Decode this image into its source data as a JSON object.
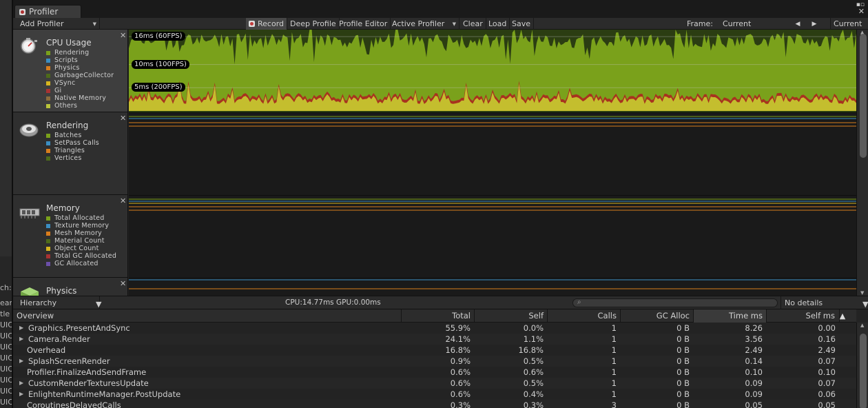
{
  "left_strip_fragments": [
    "ch:",
    "ear",
    "tle",
    "UIC",
    "UIC",
    "UIC",
    "UIC",
    "UIC",
    "UIC",
    "UIC",
    "UIC"
  ],
  "window": {
    "tab_title": "Profiler",
    "menu_icon": "menu-icon",
    "close_icon": "close-x-icon"
  },
  "toolbar": {
    "add_profiler": "Add Profiler",
    "record": "Record",
    "deep_profile": "Deep Profile",
    "profile_editor": "Profile Editor",
    "active_profiler": "Active Profiler",
    "clear": "Clear",
    "load": "Load",
    "save": "Save",
    "frame_label": "Frame:",
    "frame_value": "Current",
    "prev_icon": "prev-frame-icon",
    "next_icon": "next-frame-icon",
    "current_button": "Current"
  },
  "lanes": [
    {
      "title": "CPU Usage",
      "icon": "cpu-usage-icon",
      "legend": [
        {
          "name": "Rendering",
          "color": "#7aa11b"
        },
        {
          "name": "Scripts",
          "color": "#3b8ec2"
        },
        {
          "name": "Physics",
          "color": "#d97d1c"
        },
        {
          "name": "GarbageCollector",
          "color": "#4e6b1a"
        },
        {
          "name": "VSync",
          "color": "#d6b51f"
        },
        {
          "name": "Gi",
          "color": "#a83232"
        },
        {
          "name": "Native Memory",
          "color": "#8a6c3c"
        },
        {
          "name": "Others",
          "color": "#b9c43a"
        }
      ]
    },
    {
      "title": "Rendering",
      "icon": "rendering-icon",
      "legend": [
        {
          "name": "Batches",
          "color": "#7aa11b"
        },
        {
          "name": "SetPass Calls",
          "color": "#3b8ec2"
        },
        {
          "name": "Triangles",
          "color": "#d97d1c"
        },
        {
          "name": "Vertices",
          "color": "#4e6b1a"
        }
      ]
    },
    {
      "title": "Memory",
      "icon": "memory-chip-icon",
      "legend": [
        {
          "name": "Total Allocated",
          "color": "#7aa11b"
        },
        {
          "name": "Texture Memory",
          "color": "#3b8ec2"
        },
        {
          "name": "Mesh Memory",
          "color": "#d97d1c"
        },
        {
          "name": "Material Count",
          "color": "#4e6b1a"
        },
        {
          "name": "Object Count",
          "color": "#d6b51f"
        },
        {
          "name": "Total GC Allocated",
          "color": "#a83232"
        },
        {
          "name": "GC Allocated",
          "color": "#6b4fa8"
        }
      ]
    },
    {
      "title": "Physics",
      "icon": "physics-cube-icon",
      "legend": []
    }
  ],
  "cpu_chart": {
    "fps_markers": [
      {
        "label": "16ms (60FPS)",
        "ms": 16
      },
      {
        "label": "10ms (100FPS)",
        "ms": 10
      },
      {
        "label": "5ms (200FPS)",
        "ms": 5
      }
    ],
    "y_max_ms": 17.5
  },
  "hierarchy_bar": {
    "view_mode": "Hierarchy",
    "stats": "CPU:14.77ms   GPU:0.00ms",
    "search_icon": "search-icon",
    "details_mode": "No details"
  },
  "table": {
    "columns": [
      "Overview",
      "Total",
      "Self",
      "Calls",
      "GC Alloc",
      "Time ms",
      "Self ms"
    ],
    "sorted_column": "Time ms",
    "sort_icon": "sort-descending-icon",
    "rows": [
      {
        "name": "Graphics.PresentAndSync",
        "expandable": true,
        "total": "55.9%",
        "self": "0.0%",
        "calls": "1",
        "gc": "0 B",
        "time": "8.26",
        "selfms": "0.00"
      },
      {
        "name": "Camera.Render",
        "expandable": true,
        "total": "24.1%",
        "self": "1.1%",
        "calls": "1",
        "gc": "0 B",
        "time": "3.56",
        "selfms": "0.16"
      },
      {
        "name": "Overhead",
        "expandable": false,
        "total": "16.8%",
        "self": "16.8%",
        "calls": "1",
        "gc": "0 B",
        "time": "2.49",
        "selfms": "2.49"
      },
      {
        "name": "SplashScreenRender",
        "expandable": true,
        "total": "0.9%",
        "self": "0.5%",
        "calls": "1",
        "gc": "0 B",
        "time": "0.14",
        "selfms": "0.07"
      },
      {
        "name": "Profiler.FinalizeAndSendFrame",
        "expandable": false,
        "total": "0.6%",
        "self": "0.6%",
        "calls": "1",
        "gc": "0 B",
        "time": "0.10",
        "selfms": "0.10"
      },
      {
        "name": "CustomRenderTexturesUpdate",
        "expandable": true,
        "total": "0.6%",
        "self": "0.5%",
        "calls": "1",
        "gc": "0 B",
        "time": "0.09",
        "selfms": "0.07"
      },
      {
        "name": "EnlightenRuntimeManager.PostUpdate",
        "expandable": true,
        "total": "0.6%",
        "self": "0.4%",
        "calls": "1",
        "gc": "0 B",
        "time": "0.09",
        "selfms": "0.06"
      },
      {
        "name": "CoroutinesDelayedCalls",
        "expandable": false,
        "total": "0.3%",
        "self": "0.3%",
        "calls": "3",
        "gc": "0 B",
        "time": "0.05",
        "selfms": "0.05"
      }
    ]
  }
}
